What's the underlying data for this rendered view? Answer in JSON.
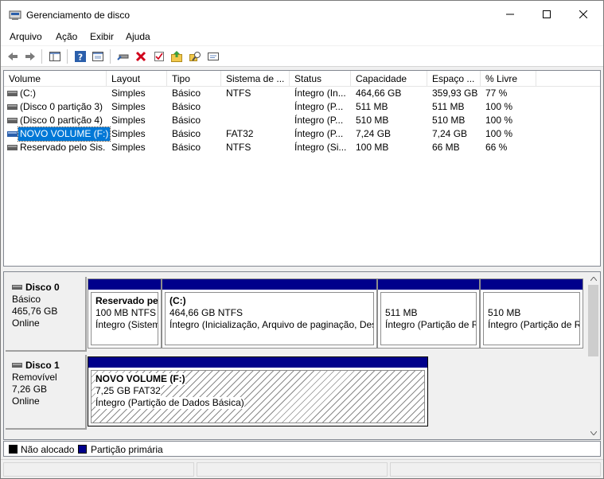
{
  "window": {
    "title": "Gerenciamento de disco",
    "icon": "disk-management-icon"
  },
  "menu": [
    "Arquivo",
    "Ação",
    "Exibir",
    "Ajuda"
  ],
  "toolbar": {
    "icons": [
      "back-arrow-icon",
      "forward-arrow-icon",
      "console-tree-icon",
      "help-icon",
      "properties-icon",
      "connect-drive-icon",
      "delete-icon",
      "check-icon",
      "open-folder-icon",
      "explore-icon",
      "console-icon"
    ]
  },
  "volume_list": {
    "columns": [
      "Volume",
      "Layout",
      "Tipo",
      "Sistema de ...",
      "Status",
      "Capacidade",
      "Espaço ...",
      "% Livre"
    ],
    "rows": [
      {
        "volume": " (C:)",
        "layout": "Simples",
        "tipo": "Básico",
        "sistema": "NTFS",
        "status": "Íntegro (In...",
        "capacidade": "464,66 GB",
        "espaco": "359,93 GB",
        "livre": "77 %"
      },
      {
        "volume": "(Disco 0 partição 3)",
        "layout": "Simples",
        "tipo": "Básico",
        "sistema": "",
        "status": "Íntegro (P...",
        "capacidade": "511 MB",
        "espaco": "511 MB",
        "livre": "100 %"
      },
      {
        "volume": "(Disco 0 partição 4)",
        "layout": "Simples",
        "tipo": "Básico",
        "sistema": "",
        "status": "Íntegro (P...",
        "capacidade": "510 MB",
        "espaco": "510 MB",
        "livre": "100 %"
      },
      {
        "volume": "NOVO VOLUME (F:)",
        "layout": "Simples",
        "tipo": "Básico",
        "sistema": "FAT32",
        "status": "Íntegro (P...",
        "capacidade": "7,24 GB",
        "espaco": "7,24 GB",
        "livre": "100 %"
      },
      {
        "volume": "Reservado pelo Sis...",
        "layout": "Simples",
        "tipo": "Básico",
        "sistema": "NTFS",
        "status": "Íntegro (Si...",
        "capacidade": "100 MB",
        "espaco": "66 MB",
        "livre": "66 %"
      }
    ]
  },
  "disks": [
    {
      "name": "Disco 0",
      "type": "Básico",
      "size": "465,76 GB",
      "state": "Online",
      "partitions": [
        {
          "title": "Reservado pel",
          "size": "100 MB NTFS",
          "status": "Íntegro (Sistem"
        },
        {
          "title": " (C:)",
          "size": "464,66 GB NTFS",
          "status": "Íntegro (Inicialização, Arquivo de paginação, Des"
        },
        {
          "title": "",
          "size": "511 MB",
          "status": "Íntegro (Partição de R"
        },
        {
          "title": "",
          "size": "510 MB",
          "status": "Íntegro (Partição de R"
        }
      ]
    },
    {
      "name": "Disco 1",
      "type": "Removível",
      "size": "7,26 GB",
      "state": "Online",
      "partitions": [
        {
          "title": "NOVO VOLUME  (F:)",
          "size": "7,25 GB FAT32",
          "status": "Íntegro (Partição de Dados Básica)"
        }
      ]
    }
  ],
  "legend": {
    "unallocated": "Não alocado",
    "primary": "Partição primária",
    "unallocated_color": "#000000",
    "primary_color": "#00008b"
  },
  "colors": {
    "selection": "#0078d7",
    "partition_bar": "#00008b"
  }
}
